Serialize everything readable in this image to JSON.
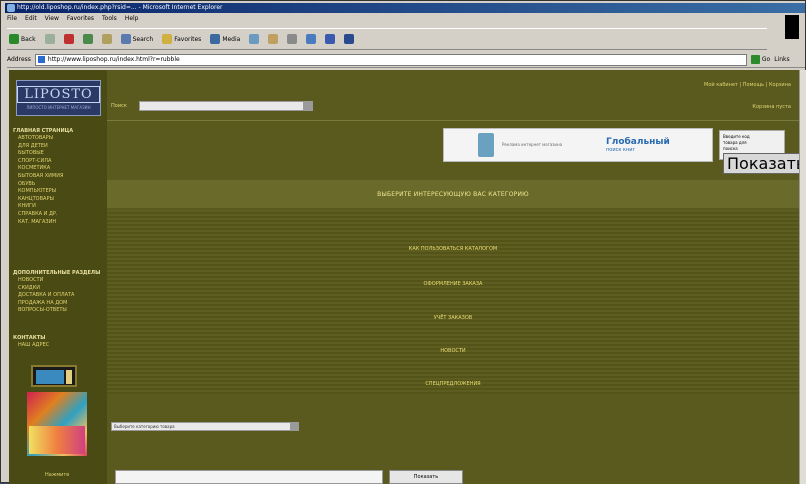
{
  "browser": {
    "title": "http://old.liposhop.ru/index.php?rsid=... - Microsoft Internet Explorer",
    "menu": [
      "File",
      "Edit",
      "View",
      "Favorites",
      "Tools",
      "Help"
    ],
    "toolbar": {
      "back": "Back",
      "search": "Search",
      "favorites": "Favorites",
      "media": "Media"
    },
    "address_label": "Address",
    "address_value": "http://www.liposhop.ru/index.html?r=rubble",
    "go": "Go",
    "links": "Links"
  },
  "sidebar": {
    "logo_text": "LIPOSTO",
    "logo_sub": "ЛИПОСТО ИНТЕРНЕТ МАГАЗИН",
    "group1_head": "Главная страница",
    "group1": [
      "Автотовары",
      "Для детей",
      "Бытовые",
      "Спорт-сила",
      "Косметика",
      "Бытовая химия",
      "Обувь",
      "Компьютеры",
      "Канцтовары",
      "Книги",
      "Справка и др.",
      "Кат. магазин"
    ],
    "group2_head": "Дополнительные разделы",
    "group2": [
      "Новости",
      "Скидки",
      "Доставка и оплата",
      "Продажа на дом",
      "Вопросы-ответы"
    ],
    "group3_head": "Контакты",
    "group3": [
      "Наш адрес"
    ],
    "bottom_link": "Нажмите"
  },
  "main": {
    "search_label": "Поиск",
    "top_link": "Мой кабинет | Помощь | Корзина",
    "top_link2": "Корзина пуста",
    "banner_text": "Реклама интернет магазина",
    "banner_title": "Глобальный",
    "banner_sub": "поиск книг",
    "sidebox_lines": [
      "Введите код",
      "товара для",
      "поиска"
    ],
    "sidebox_btn": "Показать",
    "section_title": "ВЫБЕРИТЕ ИНТЕРЕСУЮЩУЮ ВАС КАТЕГОРИЮ",
    "rows": [
      "КАК ПОЛЬЗОВАТЬСЯ КАТАЛОГОМ",
      "ОФОРМЛЕНИЕ ЗАКАЗА",
      "УЧЁТ ЗАКАЗОВ",
      "НОВОСТИ",
      "СПЕЦПРЕДЛОЖЕНИЯ"
    ],
    "select_value": "Выберите категорию товара",
    "bottom_btn": "Показать"
  }
}
